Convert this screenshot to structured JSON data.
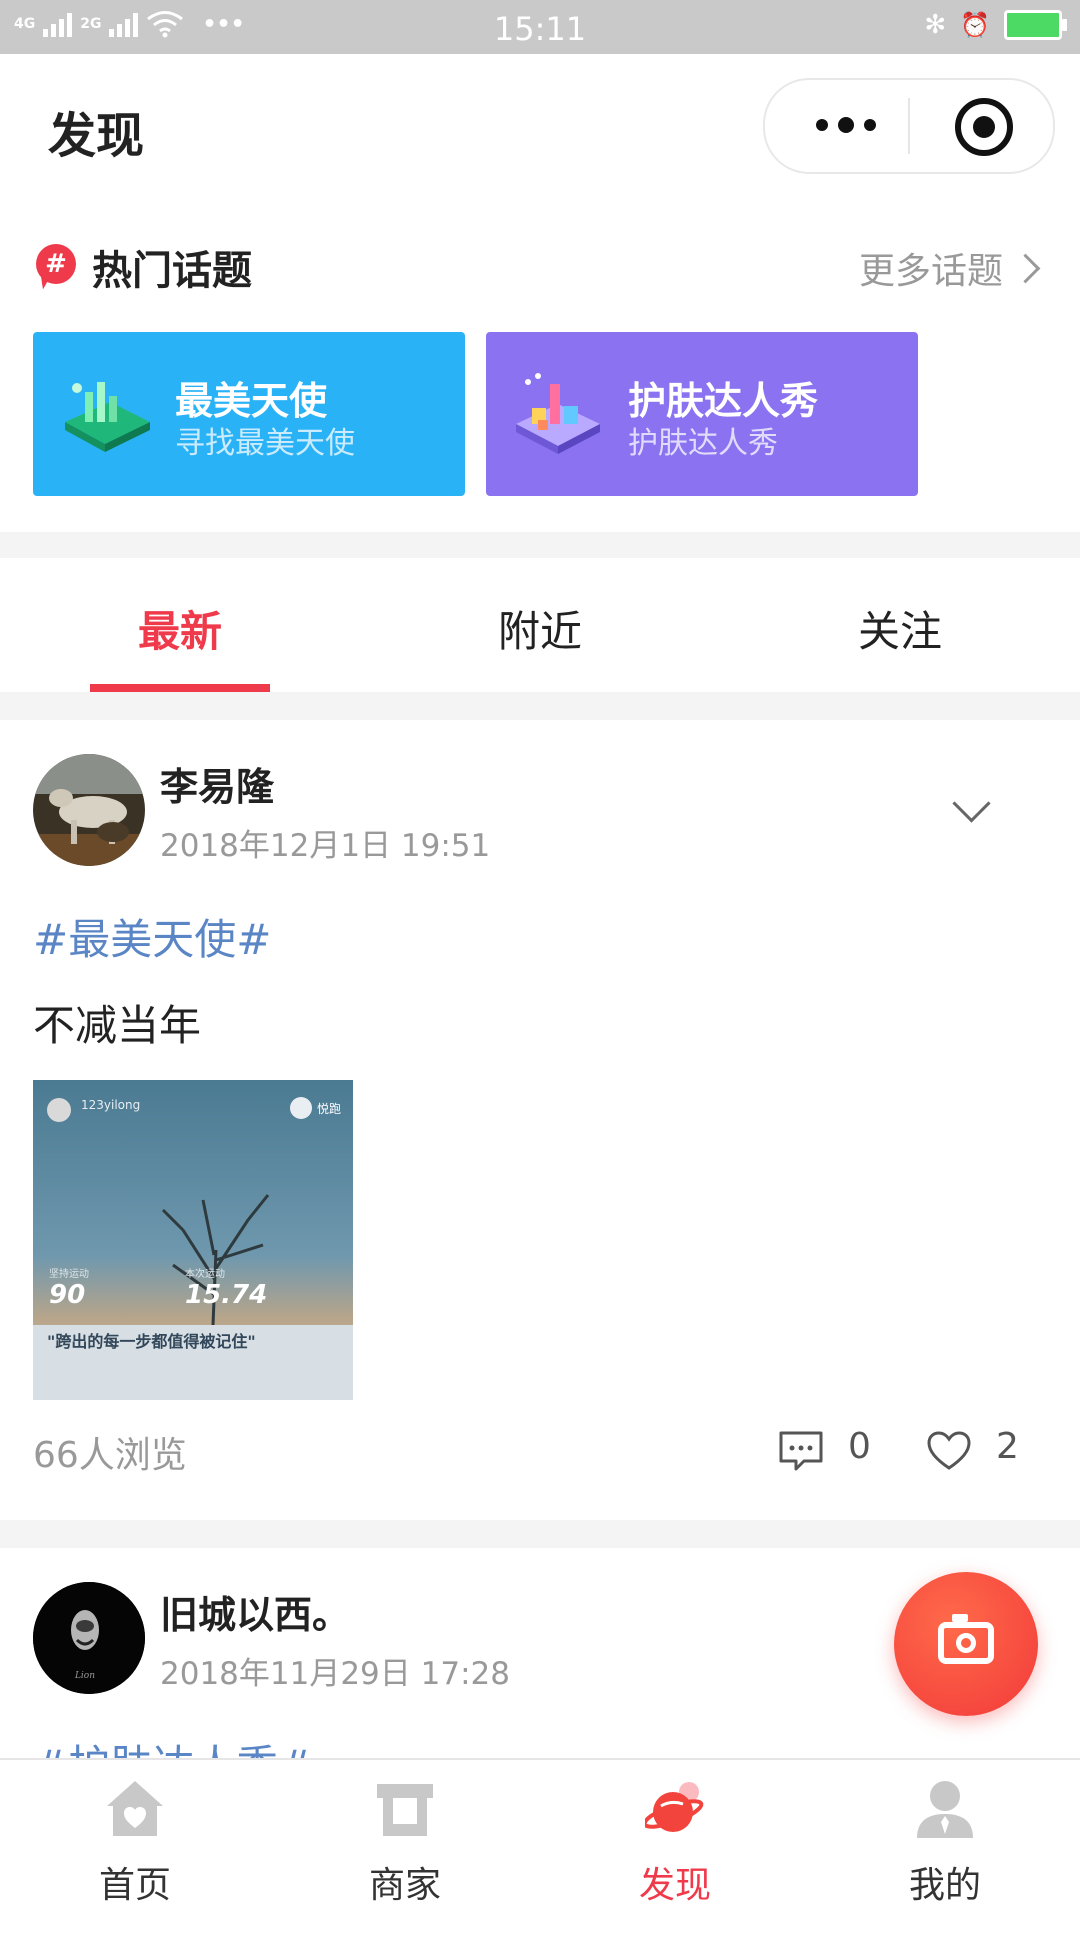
{
  "status_bar": {
    "network_1": "4G",
    "network_2": "2G",
    "dots": "•••",
    "time": "15:11",
    "bluetooth": "✻",
    "alarm": "⏰"
  },
  "header": {
    "title": "发现"
  },
  "hot_topics": {
    "title": "热门话题",
    "hash_symbol": "#",
    "more_label": "更多话题",
    "cards": [
      {
        "title": "最美天使",
        "subtitle": "寻找最美天使",
        "color": "#2ab2f6"
      },
      {
        "title": "护肤达人秀",
        "subtitle": "护肤达人秀",
        "color": "#8a72f0"
      }
    ]
  },
  "tabs": [
    {
      "label": "最新",
      "active": true
    },
    {
      "label": "附近",
      "active": false
    },
    {
      "label": "关注",
      "active": false
    }
  ],
  "posts": [
    {
      "author": "李易隆",
      "time": "2018年12月1日 19:51",
      "topic": "#最美天使#",
      "text": "不减当年",
      "image": {
        "user": "123yilong",
        "badge": "悦跑",
        "stat1_label": "坚持运动",
        "stat1_value": "90",
        "stat2_label": "本次运动",
        "stat2_value": "15.74",
        "quote": "\"跨出的每一步都值得被记住\""
      },
      "views": "66人浏览",
      "comments": "0",
      "likes": "2"
    },
    {
      "author": "旧城以西。",
      "time": "2018年11月29日 17:28",
      "topic": "#护肤达人秀#"
    }
  ],
  "bottom_nav": [
    {
      "label": "首页",
      "icon": "home-icon",
      "active": false
    },
    {
      "label": "商家",
      "icon": "shop-icon",
      "active": false
    },
    {
      "label": "发现",
      "icon": "planet-icon",
      "active": true
    },
    {
      "label": "我的",
      "icon": "profile-icon",
      "active": false
    }
  ],
  "colors": {
    "accent": "#ef3a4b",
    "topic_link": "#5a86c6",
    "muted": "#999999"
  }
}
